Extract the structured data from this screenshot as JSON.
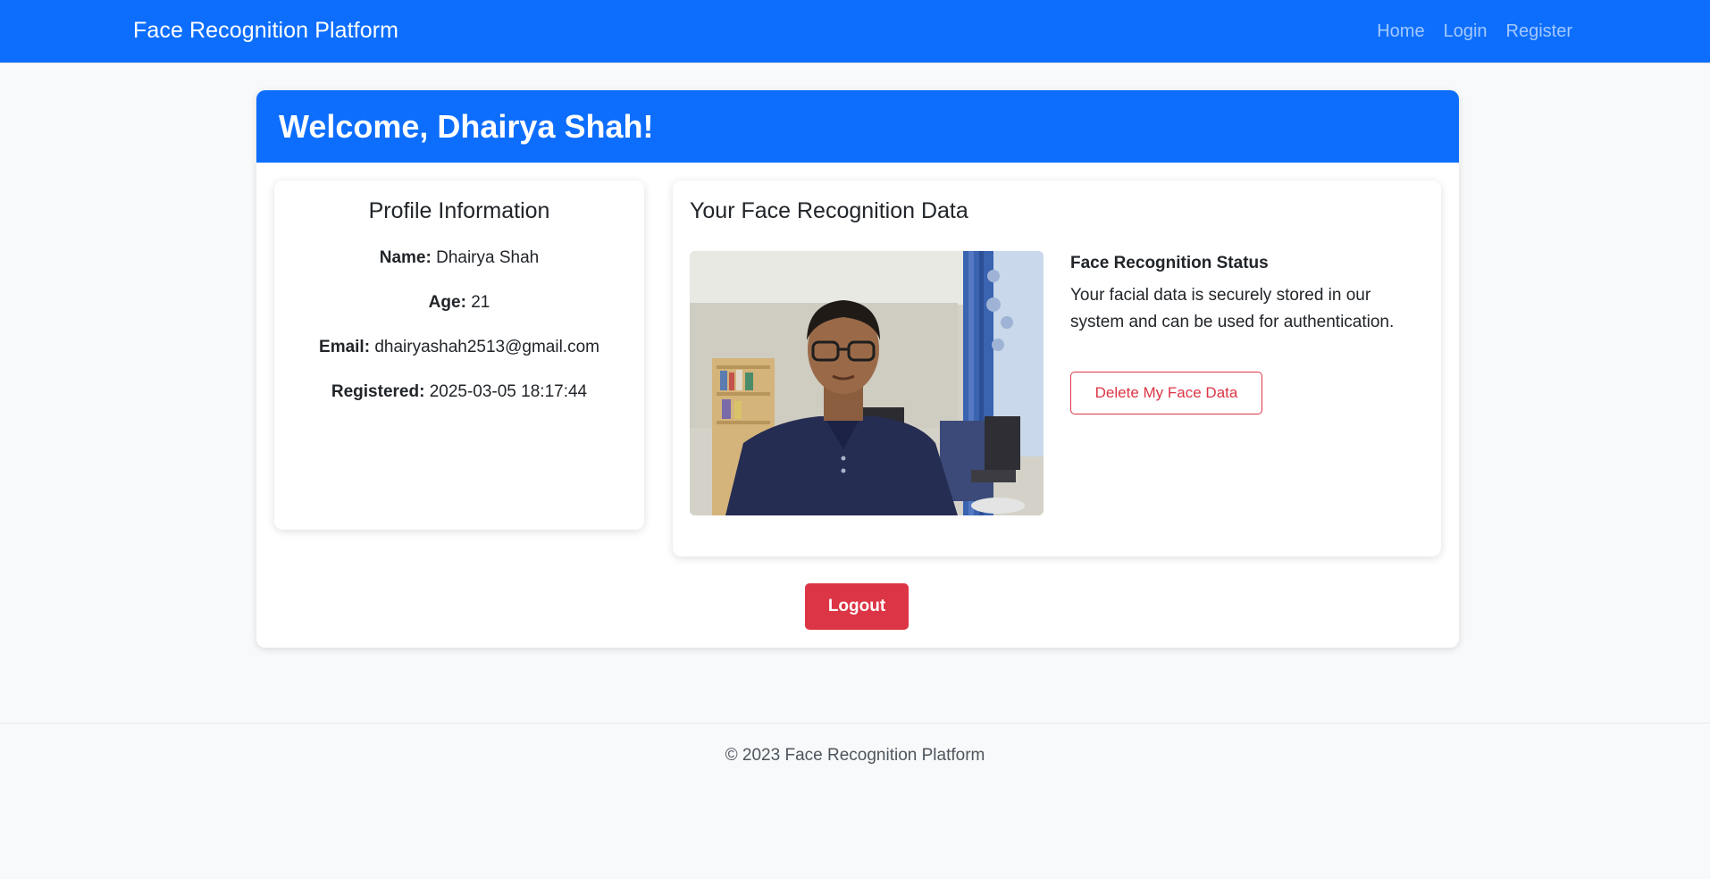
{
  "navbar": {
    "brand": "Face Recognition Platform",
    "links": [
      "Home",
      "Login",
      "Register"
    ]
  },
  "welcome": {
    "title": "Welcome, Dhairya Shah!"
  },
  "profile": {
    "title": "Profile Information",
    "fields": [
      {
        "label": "Name:",
        "value": "Dhairya Shah"
      },
      {
        "label": "Age:",
        "value": "21"
      },
      {
        "label": "Email:",
        "value": "dhairyashah2513@gmail.com"
      },
      {
        "label": "Registered:",
        "value": "2025-03-05 18:17:44"
      }
    ]
  },
  "face_data": {
    "title": "Your Face Recognition Data",
    "status_title": "Face Recognition Status",
    "status_text": "Your facial data is securely stored in our system and can be used for authentication.",
    "delete_label": "Delete My Face Data"
  },
  "actions": {
    "logout_label": "Logout"
  },
  "footer": {
    "text": "© 2023 Face Recognition Platform"
  },
  "colors": {
    "primary": "#0d6efd",
    "danger": "#dc3545",
    "background": "#f8f9fa"
  }
}
